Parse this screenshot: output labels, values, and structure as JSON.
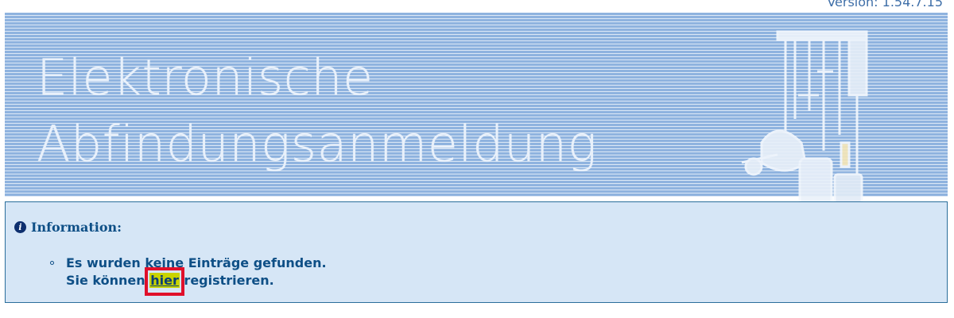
{
  "header": {
    "version": "Version: 1.54.7.15"
  },
  "banner": {
    "title_line1": "Elektronische",
    "title_line2": "Abfindungsanmeldung"
  },
  "info": {
    "title": "Information:",
    "line1": "Es wurden keine Einträge gefunden.",
    "line2_prefix": "Sie können ",
    "link_label": "hier",
    "line2_suffix": " registrieren."
  },
  "colors": {
    "banner_stripe": "#8fb3df",
    "info_background": "#d6e6f6",
    "text": "#0e4f86",
    "link_highlight": "#c9d400",
    "annotation_box": "#e0102a"
  }
}
